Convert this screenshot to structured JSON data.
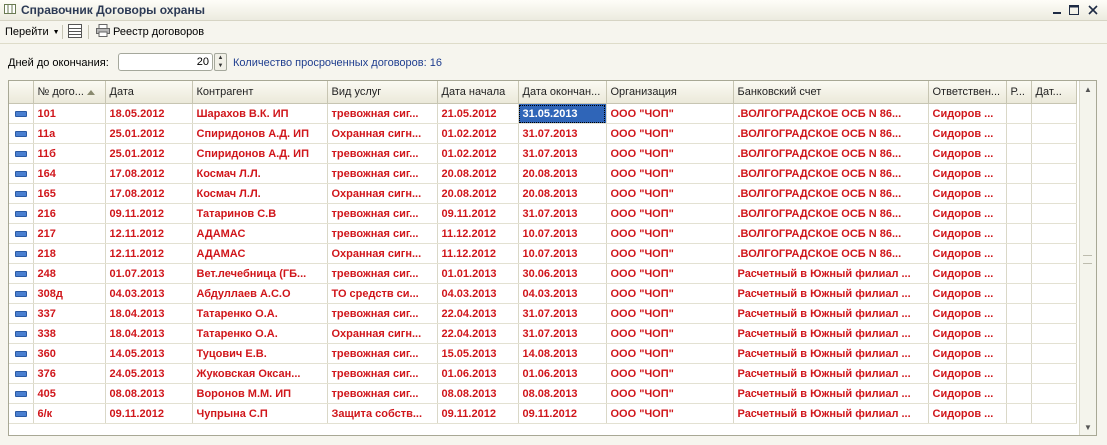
{
  "window": {
    "title": "Справочник Договоры охраны"
  },
  "toolbar": {
    "goto_label": "Перейти",
    "registry_label": "Реестр договоров"
  },
  "filter": {
    "days_label": "Дней до окончания:",
    "days_value": "20",
    "overdue_text": "Количество просроченных договоров: 16"
  },
  "table": {
    "columns": [
      "",
      "№ дого...",
      "Дата",
      "Контрагент",
      "Вид услуг",
      "Дата начала",
      "Дата окончан...",
      "Организация",
      "Банковский счет",
      "Ответствен...",
      "Р...",
      "Дат..."
    ],
    "rows": [
      [
        "101",
        "18.05.2012",
        "Шарахов В.К. ИП",
        "тревожная сиг...",
        "21.05.2012",
        "31.05.2013",
        "ООО \"ЧОП\"",
        ".ВОЛГОГРАДСКОЕ ОСБ N 86...",
        "Сидоров ..."
      ],
      [
        "11а",
        "25.01.2012",
        "Спиридонов А.Д. ИП",
        "Охранная сигн...",
        "01.02.2012",
        "31.07.2013",
        "ООО \"ЧОП\"",
        ".ВОЛГОГРАДСКОЕ ОСБ N 86...",
        "Сидоров ..."
      ],
      [
        "11б",
        "25.01.2012",
        "Спиридонов А.Д. ИП",
        "тревожная сиг...",
        "01.02.2012",
        "31.07.2013",
        "ООО \"ЧОП\"",
        ".ВОЛГОГРАДСКОЕ ОСБ N 86...",
        "Сидоров ..."
      ],
      [
        "164",
        "17.08.2012",
        "Космач Л.Л.",
        "тревожная сиг...",
        "20.08.2012",
        "20.08.2013",
        "ООО \"ЧОП\"",
        ".ВОЛГОГРАДСКОЕ ОСБ N 86...",
        "Сидоров ..."
      ],
      [
        "165",
        "17.08.2012",
        "Космач Л.Л.",
        "Охранная сигн...",
        "20.08.2012",
        "20.08.2013",
        "ООО \"ЧОП\"",
        ".ВОЛГОГРАДСКОЕ ОСБ N 86...",
        "Сидоров ..."
      ],
      [
        "216",
        "09.11.2012",
        "Татаринов С.В",
        "тревожная сиг...",
        "09.11.2012",
        "31.07.2013",
        "ООО \"ЧОП\"",
        ".ВОЛГОГРАДСКОЕ ОСБ N 86...",
        "Сидоров ..."
      ],
      [
        "217",
        "12.11.2012",
        "АДАМАС",
        "тревожная сиг...",
        "11.12.2012",
        "10.07.2013",
        "ООО \"ЧОП\"",
        ".ВОЛГОГРАДСКОЕ ОСБ N 86...",
        "Сидоров ..."
      ],
      [
        "218",
        "12.11.2012",
        "АДАМАС",
        "Охранная сигн...",
        "11.12.2012",
        "10.07.2013",
        "ООО \"ЧОП\"",
        ".ВОЛГОГРАДСКОЕ ОСБ N 86...",
        "Сидоров ..."
      ],
      [
        "248",
        "01.07.2013",
        "Вет.лечебница (ГБ...",
        "тревожная сиг...",
        "01.01.2013",
        "30.06.2013",
        "ООО \"ЧОП\"",
        "Расчетный в Южный филиал ...",
        "Сидоров ..."
      ],
      [
        "308д",
        "04.03.2013",
        "Абдуллаев А.С.О",
        "ТО средств си...",
        "04.03.2013",
        "04.03.2013",
        "ООО \"ЧОП\"",
        "Расчетный в Южный филиал ...",
        "Сидоров ..."
      ],
      [
        "337",
        "18.04.2013",
        "Татаренко О.А.",
        "тревожная сиг...",
        "22.04.2013",
        "31.07.2013",
        "ООО \"ЧОП\"",
        "Расчетный в Южный филиал ...",
        "Сидоров ..."
      ],
      [
        "338",
        "18.04.2013",
        "Татаренко О.А.",
        "Охранная сигн...",
        "22.04.2013",
        "31.07.2013",
        "ООО \"ЧОП\"",
        "Расчетный в Южный филиал ...",
        "Сидоров ..."
      ],
      [
        "360",
        "14.05.2013",
        "Туцович Е.В.",
        "тревожная сиг...",
        "15.05.2013",
        "14.08.2013",
        "ООО \"ЧОП\"",
        "Расчетный в Южный филиал ...",
        "Сидоров ..."
      ],
      [
        "376",
        "24.05.2013",
        "Жуковская Оксан...",
        "тревожная сиг...",
        "01.06.2013",
        "01.06.2013",
        "ООО \"ЧОП\"",
        "Расчетный в Южный филиал ...",
        "Сидоров ..."
      ],
      [
        "405",
        "08.08.2013",
        "Воронов М.М. ИП",
        "тревожная сиг...",
        "08.08.2013",
        "08.08.2013",
        "ООО \"ЧОП\"",
        "Расчетный в Южный филиал ...",
        "Сидоров ..."
      ],
      [
        "6/к",
        "09.11.2012",
        "Чупрына С.П",
        "Защита собств...",
        "09.11.2012",
        "09.11.2012",
        "ООО \"ЧОП\"",
        "Расчетный в Южный филиал ...",
        "Сидоров ..."
      ]
    ]
  }
}
